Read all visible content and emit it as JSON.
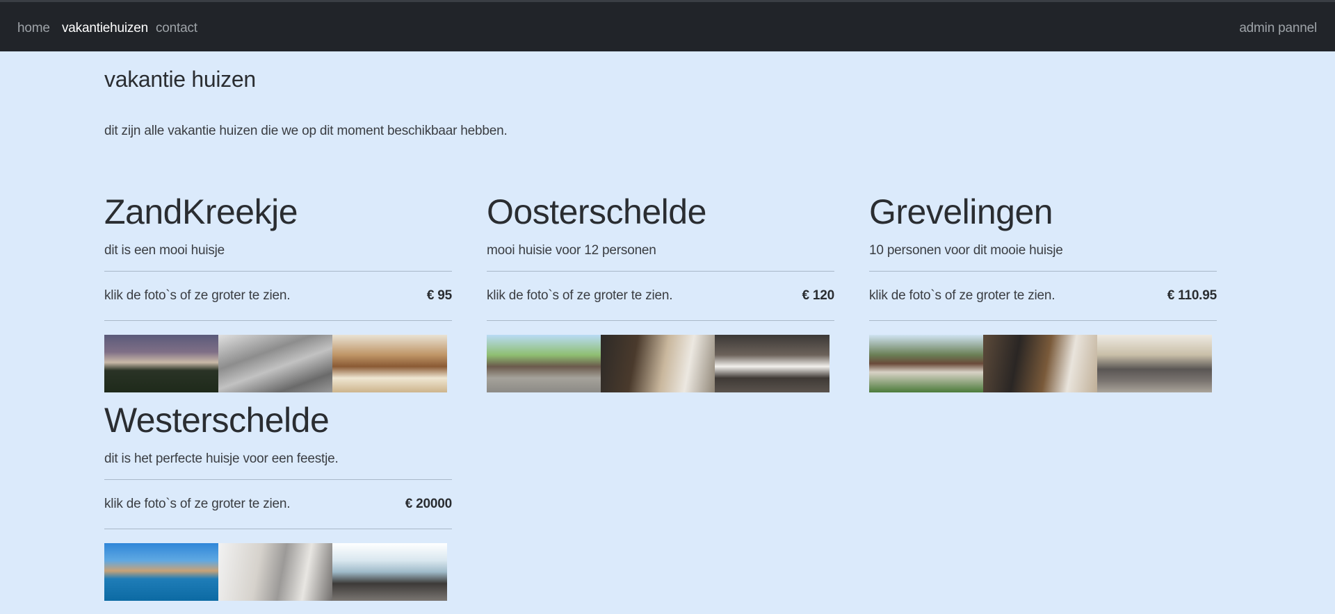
{
  "nav": {
    "home": "home",
    "vakantiehuizen": "vakantiehuizen",
    "contact": "contact",
    "admin": "admin pannel"
  },
  "page": {
    "title": "vakantie huizen",
    "intro": "dit zijn alle vakantie huizen die we op dit moment beschikbaar hebben."
  },
  "houses": [
    {
      "name": "ZandKreekje",
      "description": "dit is een mooi huisje",
      "photo_hint": "klik de foto`s of ze groter te zien.",
      "price": "€ 95"
    },
    {
      "name": "Oosterschelde",
      "description": "mooi huisie voor 12 personen",
      "photo_hint": "klik de foto`s of ze groter te zien.",
      "price": "€ 120"
    },
    {
      "name": "Grevelingen",
      "description": "10 personen voor dit mooie huisje",
      "photo_hint": "klik de foto`s of ze groter te zien.",
      "price": "€ 110.95"
    },
    {
      "name": "Westerschelde",
      "description": "dit is het perfecte huisje voor een feestje.",
      "photo_hint": "klik de foto`s of ze groter te zien.",
      "price": "€ 20000"
    }
  ],
  "colors": {
    "navbar": "#212429",
    "background": "#dbeafb",
    "nav_active": "#ffffff",
    "nav_inactive": "#9ea3a8"
  }
}
